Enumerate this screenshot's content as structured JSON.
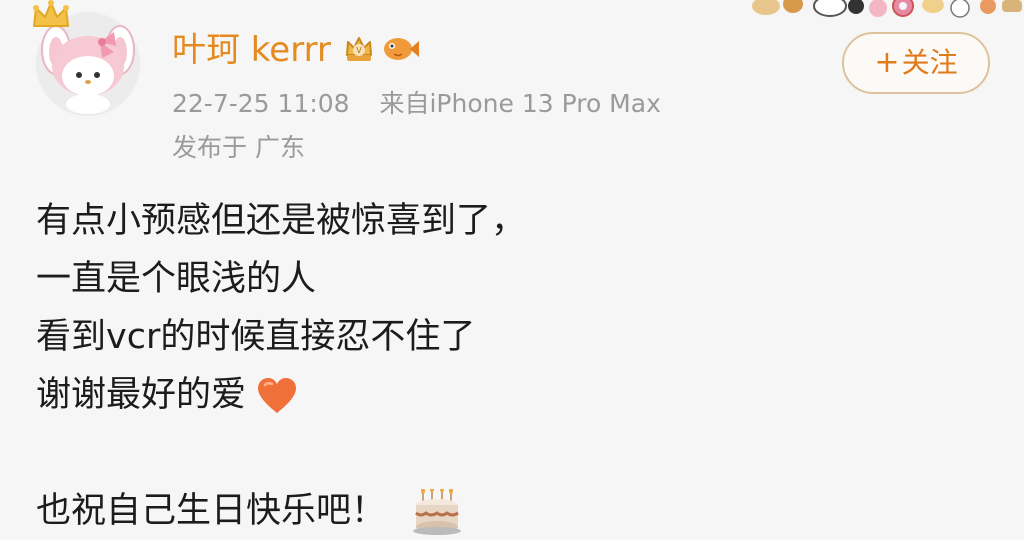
{
  "post": {
    "username": "叶珂 kerrr",
    "timestamp": "22-7-25 11:08",
    "source": "来自iPhone 13 Pro Max",
    "location": "发布于 广东",
    "follow_label": "关注",
    "lines": [
      "有点小预感但还是被惊喜到了，",
      "一直是个眼浅的人",
      "看到vcr的时候直接忍不住了",
      "谢谢最好的爱",
      "也祝自己生日快乐吧！"
    ],
    "icons": {
      "avatar": "my-melody-avatar",
      "crown": "crown-icon",
      "vip_badge": "crown-badge-icon",
      "fish_badge": "fish-badge-icon",
      "heart": "orange-heart-emoji",
      "cake": "birthday-cake-emoji",
      "stickers": "food-sticker-strip"
    },
    "colors": {
      "username": "#e58a20",
      "follow_border": "#ddc29c",
      "follow_text": "#e07b1a",
      "meta": "#9a9a9a",
      "body": "#1c1c1c",
      "background": "#f6f6f6"
    }
  }
}
